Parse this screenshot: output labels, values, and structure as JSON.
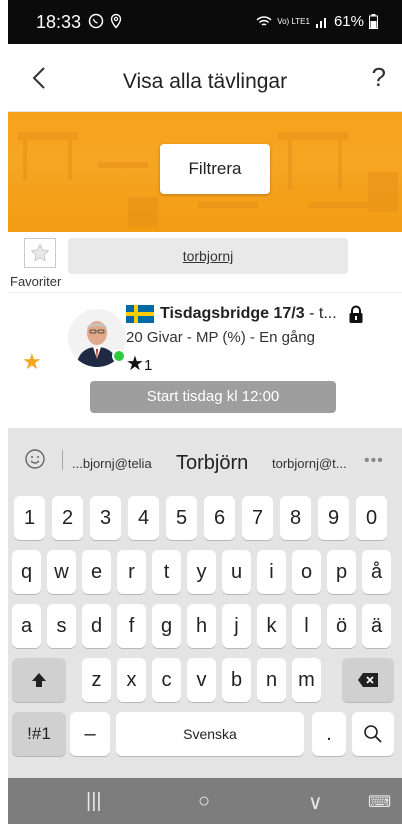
{
  "status": {
    "time": "18:33",
    "signal_text": "Vo) LTE1",
    "battery": "61%"
  },
  "header": {
    "title": "Visa alla tävlingar",
    "help": "?"
  },
  "banner": {
    "filter_label": "Filtrera"
  },
  "userbar": {
    "favorites_label": "Favoriter",
    "username": "torbjornj"
  },
  "competition": {
    "name_bold": "Tisdagsbridge 17/3",
    "name_rest": " - t...",
    "info": "20 Givar - MP (%) - En gång",
    "rating_star": "★",
    "rating_value": "1",
    "start_label": "Start tisdag kl 12:00",
    "favorite_color": "#f5a623"
  },
  "keyboard": {
    "suggestions": [
      "...bjornj@telia",
      "Torbjörn",
      "torbjornj@t...",
      "•••"
    ],
    "row_numbers": [
      "1",
      "2",
      "3",
      "4",
      "5",
      "6",
      "7",
      "8",
      "9",
      "0"
    ],
    "row1": [
      "q",
      "w",
      "e",
      "r",
      "t",
      "y",
      "u",
      "i",
      "o",
      "p",
      "å"
    ],
    "row2": [
      "a",
      "s",
      "d",
      "f",
      "g",
      "h",
      "j",
      "k",
      "l",
      "ö",
      "ä"
    ],
    "row3": [
      "z",
      "x",
      "c",
      "v",
      "b",
      "n",
      "m"
    ],
    "symbols_label": "!#1",
    "dash_label": "–",
    "space_label": "Svenska",
    "period_label": "."
  },
  "navbar": {
    "recents": "|||",
    "home": "○",
    "back": "∨",
    "keyboard": "⌨"
  },
  "colors": {
    "accent": "#f5a623",
    "start_button": "#9e9e9e",
    "online": "#2ecc40"
  }
}
